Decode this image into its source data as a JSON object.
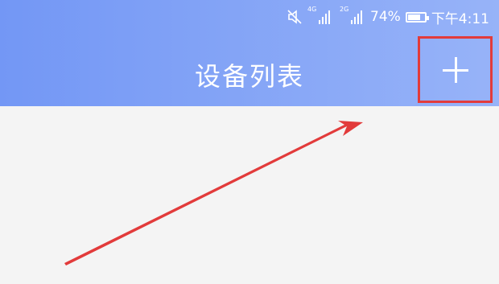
{
  "status_bar": {
    "signal1_label": "4G",
    "signal2_label": "2G",
    "battery_percent": "74%",
    "battery_level": 0.74,
    "time": "下午4:11"
  },
  "header": {
    "title": "设备列表",
    "add_icon": "plus-icon"
  },
  "colors": {
    "header_start": "#7397f5",
    "header_end": "#97b3f8",
    "highlight_box": "#e23b3b",
    "arrow": "#e23b3b",
    "background": "#f4f4f4"
  }
}
